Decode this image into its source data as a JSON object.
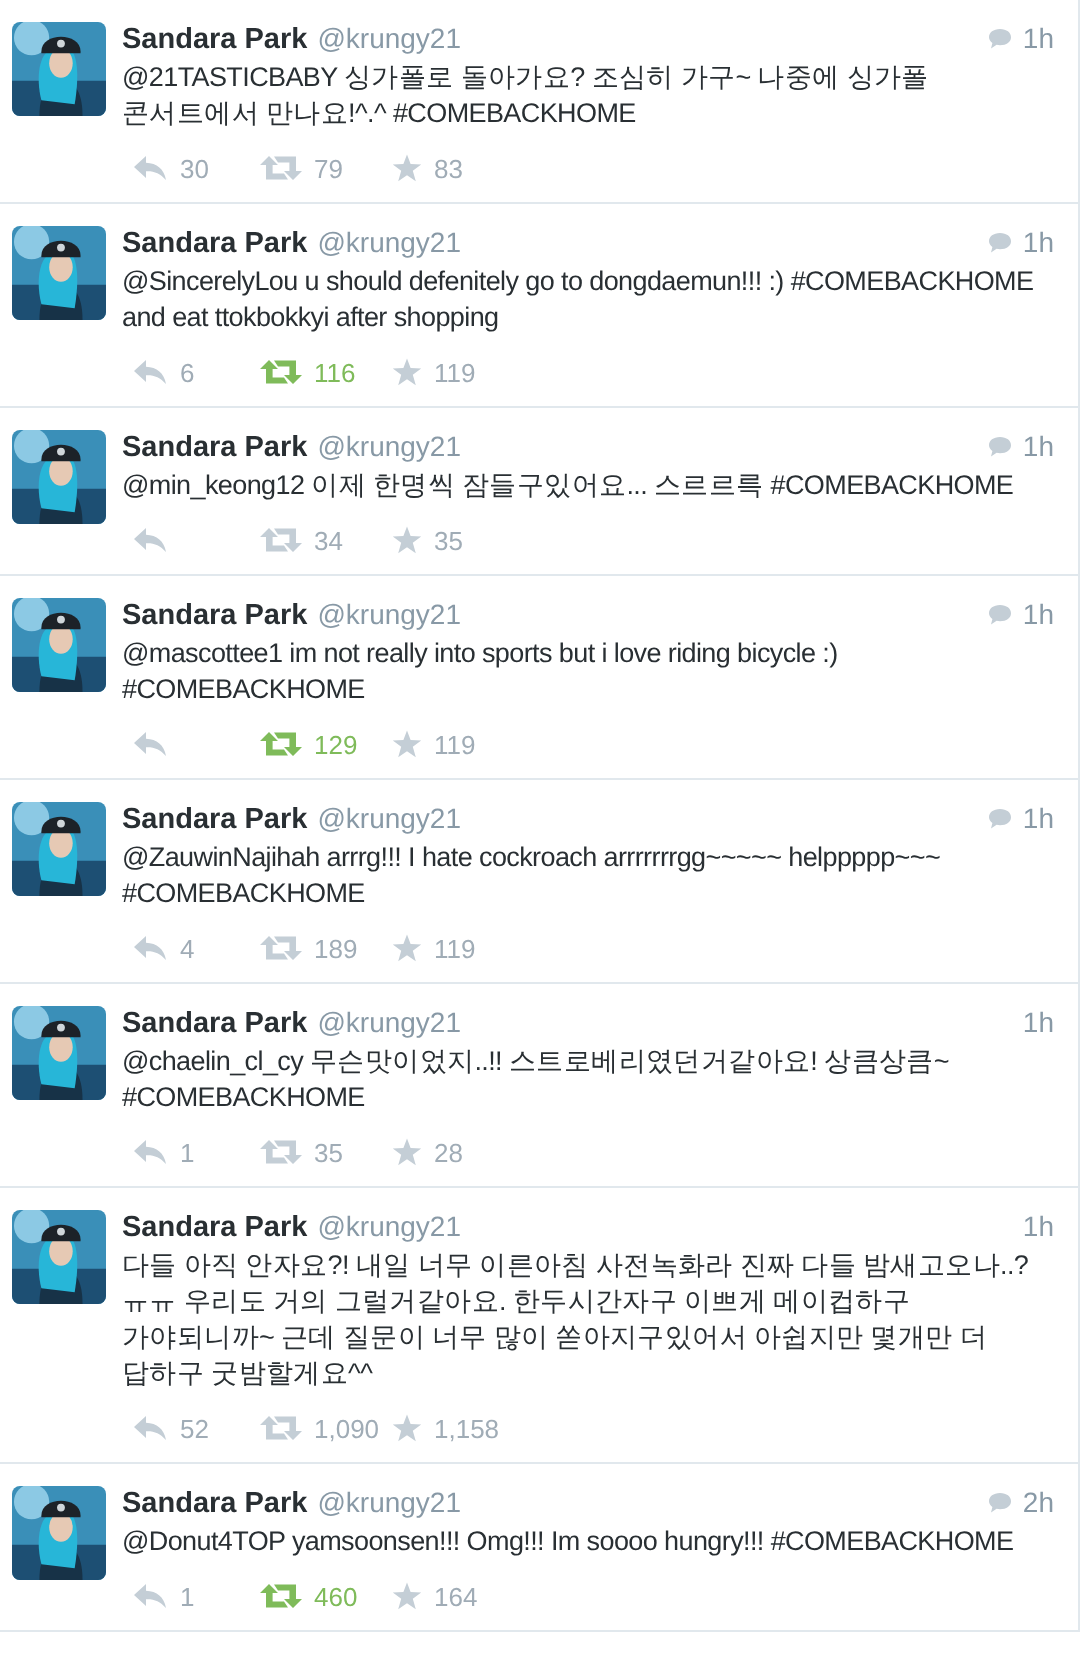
{
  "tweets": [
    {
      "name": "Sandara Park",
      "handle": "@krungy21",
      "time": "1h",
      "conversation": true,
      "text": "@21TASTICBABY 싱가폴로 돌아가요? 조심히 가구~ 나중에 싱가폴 콘서트에서 만나요!^.^ #COMEBACKHOME",
      "replies": "30",
      "retweets": "79",
      "retweeted": false,
      "favorites": "83"
    },
    {
      "name": "Sandara Park",
      "handle": "@krungy21",
      "time": "1h",
      "conversation": true,
      "text": "@SincerelyLou u should defenitely go to dongdaemun!!! :) #COMEBACKHOME  and eat ttokbokkyi after shopping",
      "replies": "6",
      "retweets": "116",
      "retweeted": true,
      "favorites": "119"
    },
    {
      "name": "Sandara Park",
      "handle": "@krungy21",
      "time": "1h",
      "conversation": true,
      "text": "@min_keong12 이제 한명씩 잠들구있어요... 스르르륵 #COMEBACKHOME",
      "retweets": "34",
      "retweeted": false,
      "favorites": "35"
    },
    {
      "name": "Sandara Park",
      "handle": "@krungy21",
      "time": "1h",
      "conversation": true,
      "text": "@mascottee1 im not really into sports but i love riding bicycle :) #COMEBACKHOME",
      "retweets": "129",
      "retweeted": true,
      "favorites": "119"
    },
    {
      "name": "Sandara Park",
      "handle": "@krungy21",
      "time": "1h",
      "conversation": true,
      "text": "@ZauwinNajihah arrrg!!! I hate cockroach arrrrrrrgg~~~~~ helppppp~~~ #COMEBACKHOME",
      "replies": "4",
      "retweets": "189",
      "retweeted": false,
      "favorites": "119"
    },
    {
      "name": "Sandara Park",
      "handle": "@krungy21",
      "time": "1h",
      "conversation": false,
      "text": "@chaelin_cl_cy 무슨맛이었지..!! 스트로베리였던거같아요! 상큼상큼~ #COMEBACKHOME",
      "replies": "1",
      "retweets": "35",
      "retweeted": false,
      "favorites": "28"
    },
    {
      "name": "Sandara Park",
      "handle": "@krungy21",
      "time": "1h",
      "conversation": false,
      "text": "다들 아직 안자요?! 내일 너무 이른아침 사전녹화라 진짜 다들 밤새고오나..?ㅠㅠ 우리도 거의 그럴거같아요. 한두시간자구 이쁘게 메이컵하구 가야되니까~ 근데 질문이 너무 많이 쏟아지구있어서 아쉽지만 몇개만 더 답하구 굿밤할게요^^",
      "replies": "52",
      "retweets": "1,090",
      "retweeted": false,
      "favorites": "1,158"
    },
    {
      "name": "Sandara Park",
      "handle": "@krungy21",
      "time": "2h",
      "conversation": true,
      "text": "@Donut4TOP yamsoonsen!!! Omg!!! Im soooo hungry!!! #COMEBACKHOME",
      "replies": "1",
      "retweets": "460",
      "retweeted": true,
      "favorites": "164"
    }
  ]
}
